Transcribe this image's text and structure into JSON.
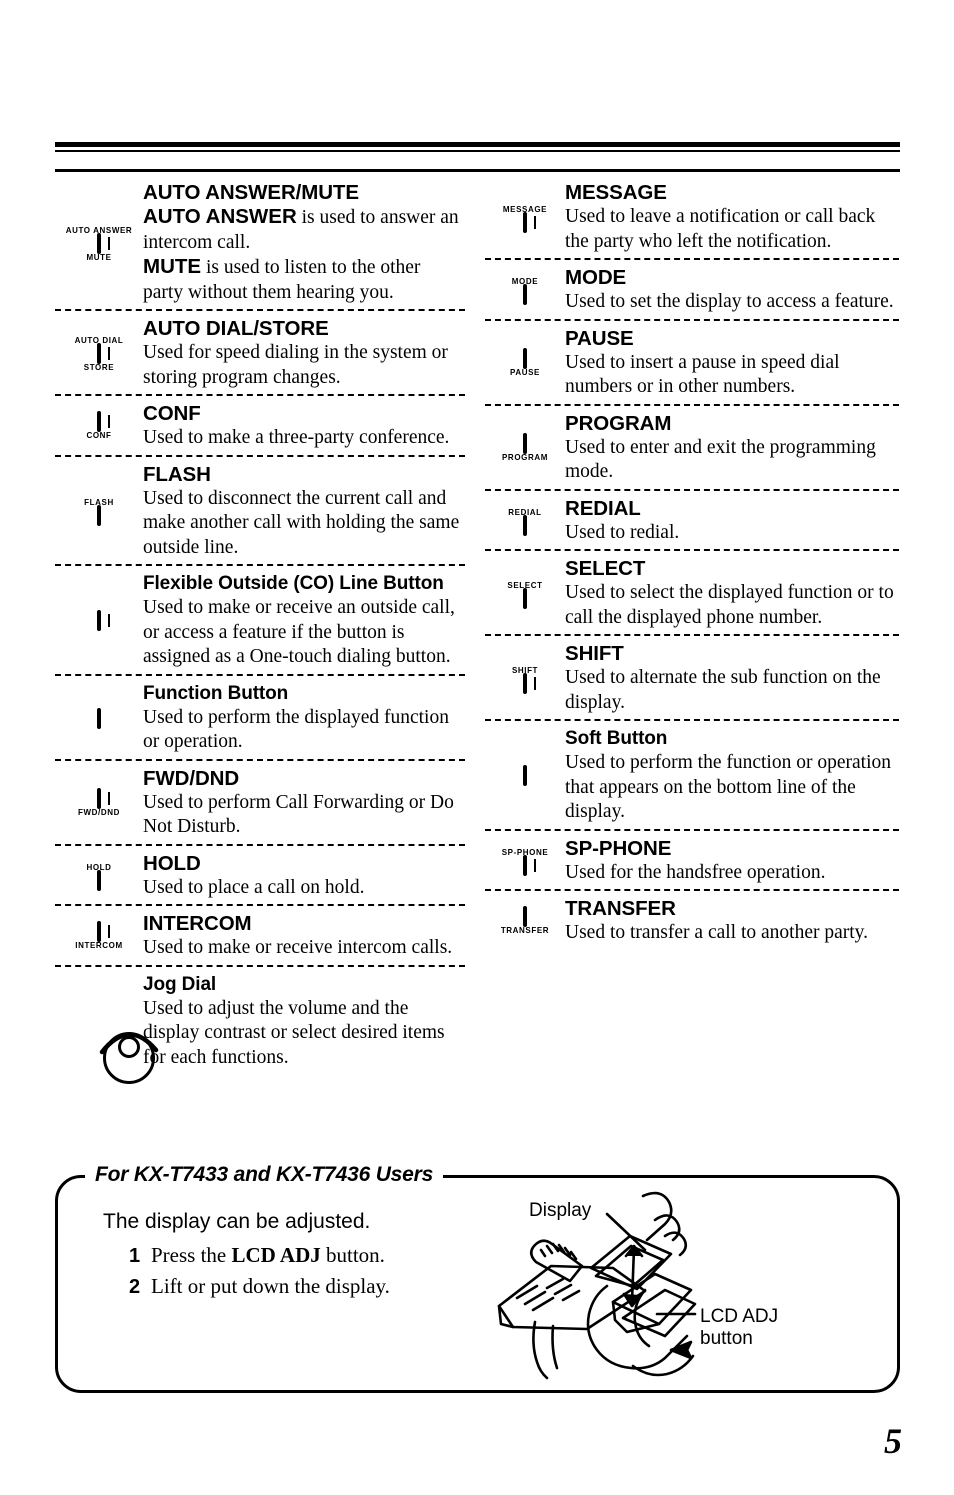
{
  "page": {
    "number": "5"
  },
  "left_column": [
    {
      "icon_top_label": "AUTO ANSWER",
      "icon_bottom_label": "MUTE",
      "icon_type": "key-led",
      "title": "AUTO ANSWER/MUTE",
      "body_html": "<b>AUTO ANSWER</b> is used to answer an intercom call.<br><b>MUTE</b> is used to listen to the other party without them hearing you."
    },
    {
      "icon_top_label": "AUTO DIAL",
      "icon_bottom_label": "STORE",
      "icon_type": "key-led",
      "title": "AUTO DIAL/STORE",
      "body_html": "Used for speed dialing in the system or storing program changes."
    },
    {
      "icon_top_label": "",
      "icon_bottom_label": "CONF",
      "icon_type": "key-led",
      "title": "CONF",
      "body_html": "Used to make a three-party conference."
    },
    {
      "icon_top_label": "FLASH",
      "icon_bottom_label": "",
      "icon_type": "key-plain",
      "title": "FLASH",
      "body_html": "Used to disconnect the current call and make another call with holding the same outside line."
    },
    {
      "icon_top_label": "",
      "icon_bottom_label": "",
      "icon_type": "key-led",
      "title": "Flexible Outside (CO) Line Button",
      "body_html": "Used to make or receive an outside call, or access a feature if the button is assigned as a One-touch dialing button."
    },
    {
      "icon_top_label": "",
      "icon_bottom_label": "",
      "icon_type": "key-soft",
      "title": "Function Button",
      "body_html": "Used to perform the displayed function or operation."
    },
    {
      "icon_top_label": "",
      "icon_bottom_label": "FWD/DND",
      "icon_type": "key-led",
      "title": "FWD/DND",
      "body_html": "Used to perform Call Forwarding or Do Not Disturb."
    },
    {
      "icon_top_label": "HOLD",
      "icon_bottom_label": "",
      "icon_type": "key-plain-tall",
      "title": "HOLD",
      "body_html": "Used to place a call on hold."
    },
    {
      "icon_top_label": "",
      "icon_bottom_label": "INTERCOM",
      "icon_type": "key-led",
      "title": "INTERCOM",
      "body_html": "Used to make or receive intercom calls."
    },
    {
      "icon_top_label": "",
      "icon_bottom_label": "",
      "icon_type": "jog-dial",
      "title": "Jog Dial",
      "body_html": "Used to adjust the volume and the display contrast or select desired items for each functions."
    }
  ],
  "right_column": [
    {
      "icon_top_label": "MESSAGE",
      "icon_bottom_label": "",
      "icon_type": "key-led",
      "title": "MESSAGE",
      "body_html": "Used to leave a notification or call back the party who left the notification."
    },
    {
      "icon_top_label": "MODE",
      "icon_bottom_label": "",
      "icon_type": "key-plain-narrow",
      "title": "MODE",
      "body_html": "Used to set the display to access a feature."
    },
    {
      "icon_top_label": "",
      "icon_bottom_label": "PAUSE",
      "icon_type": "key-plain",
      "title": "PAUSE",
      "body_html": "Used to insert a pause in speed dial numbers or in other numbers."
    },
    {
      "icon_top_label": "",
      "icon_bottom_label": "PROGRAM",
      "icon_type": "key-plain",
      "title": "PROGRAM",
      "body_html": "Used to enter and exit the programming mode."
    },
    {
      "icon_top_label": "REDIAL",
      "icon_bottom_label": "",
      "icon_type": "key-plain-tall",
      "title": "REDIAL",
      "body_html": "Used to redial."
    },
    {
      "icon_top_label": "SELECT",
      "icon_bottom_label": "",
      "icon_type": "key-plain-narrow",
      "title": "SELECT",
      "body_html": "Used to select the displayed function or to call the displayed phone number."
    },
    {
      "icon_top_label": "SHIFT",
      "icon_bottom_label": "",
      "icon_type": "key-led-narrow",
      "title": "SHIFT",
      "body_html": "Used to alternate the sub function on the display."
    },
    {
      "icon_top_label": "",
      "icon_bottom_label": "",
      "icon_type": "key-soft",
      "title": "Soft Button",
      "body_html": "Used to perform the function or operation that appears on the bottom line of the display."
    },
    {
      "icon_top_label": "SP-PHONE",
      "icon_bottom_label": "",
      "icon_type": "key-led",
      "title": "SP-PHONE",
      "body_html": "Used for the handsfree operation."
    },
    {
      "icon_top_label": "",
      "icon_bottom_label": "TRANSFER",
      "icon_type": "key-plain",
      "title": "TRANSFER",
      "body_html": "Used to transfer a call to another party."
    }
  ],
  "callout": {
    "title": "For KX-T7433 and KX-T7436 Users",
    "lead": "The display can be adjusted.",
    "steps": [
      {
        "num": "1",
        "text_html": "Press the <b>LCD ADJ</b> button."
      },
      {
        "num": "2",
        "text_html": "Lift or put down the display."
      }
    ],
    "illustration_labels": {
      "display": "Display",
      "lcd_adj": "LCD ADJ\nbutton"
    }
  }
}
